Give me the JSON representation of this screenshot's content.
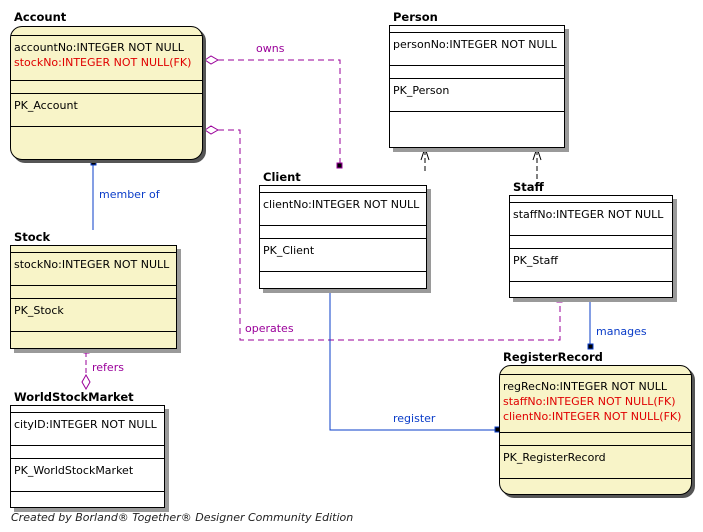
{
  "diagram": {
    "footer": "Created by Borland® Together® Designer Community Edition",
    "colors": {
      "table_fill": "#f8f4c8",
      "fk_text": "#e00000",
      "aggregation_line": "#9a009a",
      "association_line": "#0a3cc8"
    },
    "entities": {
      "account": {
        "name": "Account",
        "columns": [
          {
            "text": "accountNo:INTEGER NOT NULL",
            "fk": false
          },
          {
            "text": "stockNo:INTEGER NOT NULL(FK)",
            "fk": true
          }
        ],
        "keys": [
          "PK_Account"
        ]
      },
      "person": {
        "name": "Person",
        "columns": [
          {
            "text": "personNo:INTEGER NOT NULL",
            "fk": false
          }
        ],
        "keys": [
          "PK_Person"
        ]
      },
      "client": {
        "name": "Client",
        "columns": [
          {
            "text": "clientNo:INTEGER NOT NULL",
            "fk": false
          }
        ],
        "keys": [
          "PK_Client"
        ]
      },
      "staff": {
        "name": "Staff",
        "columns": [
          {
            "text": "staffNo:INTEGER NOT NULL",
            "fk": false
          }
        ],
        "keys": [
          "PK_Staff"
        ]
      },
      "stock": {
        "name": "Stock",
        "columns": [
          {
            "text": "stockNo:INTEGER NOT NULL",
            "fk": false
          }
        ],
        "keys": [
          "PK_Stock"
        ]
      },
      "worldstockmarket": {
        "name": "WorldStockMarket",
        "columns": [
          {
            "text": "cityID:INTEGER NOT NULL",
            "fk": false
          }
        ],
        "keys": [
          "PK_WorldStockMarket"
        ]
      },
      "registerrecord": {
        "name": "RegisterRecord",
        "columns": [
          {
            "text": "regRecNo:INTEGER NOT NULL",
            "fk": false
          },
          {
            "text": "staffNo:INTEGER NOT NULL(FK)",
            "fk": true
          },
          {
            "text": "clientNo:INTEGER NOT NULL(FK)",
            "fk": true
          }
        ],
        "keys": [
          "PK_RegisterRecord"
        ]
      }
    },
    "relationships": [
      {
        "id": "owns",
        "label": "owns",
        "from": "Account",
        "to": "Client",
        "kind": "aggregation"
      },
      {
        "id": "operates",
        "label": "operates",
        "from": "Account",
        "to": "Staff",
        "kind": "aggregation"
      },
      {
        "id": "member-of",
        "label": "member of",
        "from": "Account",
        "to": "Stock",
        "kind": "association"
      },
      {
        "id": "refers",
        "label": "refers",
        "from": "Stock",
        "to": "WorldStockMarket",
        "kind": "aggregation"
      },
      {
        "id": "register",
        "label": "register",
        "from": "Client",
        "to": "RegisterRecord",
        "kind": "association"
      },
      {
        "id": "manages",
        "label": "manages",
        "from": "Staff",
        "to": "RegisterRecord",
        "kind": "association"
      },
      {
        "id": "client-generalization",
        "label": "",
        "from": "Client",
        "to": "Person",
        "kind": "dependency"
      },
      {
        "id": "staff-generalization",
        "label": "",
        "from": "Staff",
        "to": "Person",
        "kind": "dependency"
      }
    ]
  }
}
